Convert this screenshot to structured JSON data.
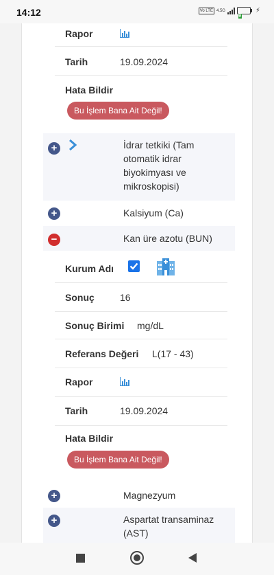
{
  "status_bar": {
    "time": "14:12",
    "volte": "Vo LTE",
    "network": "4.5G",
    "battery": "9"
  },
  "block1": {
    "rapor_label": "Rapor",
    "tarih_label": "Tarih",
    "tarih_value": "19.09.2024",
    "hata_label": "Hata Bildir",
    "report_error_button": "Bu İşlem Bana Ait Değil!"
  },
  "tests": [
    {
      "name": "İdrar tetkiki (Tam otomatik idrar biyokimyası ve mikroskopisi)",
      "name_lines": [
        "İdrar tetkiki (Tam",
        "otomatik idrar",
        "biyokimyası ve",
        "mikroskopisi)"
      ],
      "expanded": false
    },
    {
      "name": "Kalsiyum (Ca)",
      "expanded": false
    },
    {
      "name": "Kan üre azotu (BUN)",
      "expanded": true
    },
    {
      "name": "Magnezyum",
      "expanded": false
    },
    {
      "name": "Aspartat transaminaz (AST)",
      "name_lines": [
        "Aspartat transaminaz",
        "(AST)"
      ],
      "expanded": false
    }
  ],
  "bun_details": {
    "kurum_label": "Kurum Adı",
    "kurum_checked": true,
    "sonuc_label": "Sonuç",
    "sonuc_value": "16",
    "birim_label": "Sonuç Birimi",
    "birim_value": "mg/dL",
    "referans_label": "Referans Değeri",
    "referans_value": "L(17 - 43)",
    "rapor_label": "Rapor",
    "tarih_label": "Tarih",
    "tarih_value": "19.09.2024",
    "hata_label": "Hata Bildir",
    "report_error_button": "Bu İşlem Bana Ait Değil!"
  },
  "icons": {
    "report": "bar-chart-icon",
    "expand": "plus-circle-icon",
    "collapse": "minus-circle-icon",
    "chevron": "chevron-right-icon",
    "institution": "hospital-icon",
    "nav_recent": "square-icon",
    "nav_home": "circle-icon",
    "nav_back": "triangle-back-icon"
  },
  "colors": {
    "button_red": "#c9595f",
    "plus_blue": "#44578a",
    "minus_red": "#d12e2e",
    "link_blue": "#3a8fd8",
    "checkbox_blue": "#1a73e8"
  }
}
